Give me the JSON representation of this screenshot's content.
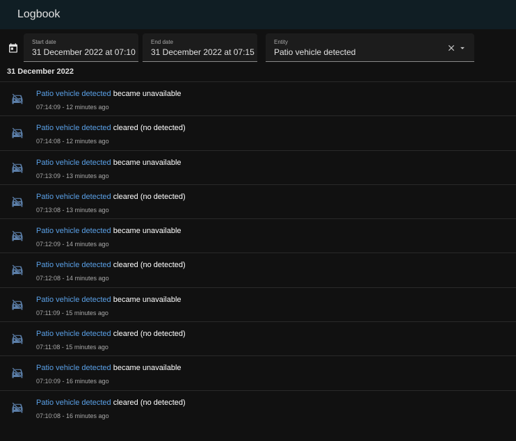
{
  "header": {
    "title": "Logbook"
  },
  "filters": {
    "start": {
      "label": "Start date",
      "value": "31 December 2022 at 07:10"
    },
    "end": {
      "label": "End date",
      "value": "31 December 2022 at 07:15"
    },
    "entity": {
      "label": "Entity",
      "value": "Patio vehicle detected"
    }
  },
  "date_group": "31 December 2022",
  "entries": [
    {
      "entity": "Patio vehicle detected",
      "action": "became unavailable",
      "time": "07:14:09 - 12 minutes ago"
    },
    {
      "entity": "Patio vehicle detected",
      "action": "cleared (no detected)",
      "time": "07:14:08 - 12 minutes ago"
    },
    {
      "entity": "Patio vehicle detected",
      "action": "became unavailable",
      "time": "07:13:09 - 13 minutes ago"
    },
    {
      "entity": "Patio vehicle detected",
      "action": "cleared (no detected)",
      "time": "07:13:08 - 13 minutes ago"
    },
    {
      "entity": "Patio vehicle detected",
      "action": "became unavailable",
      "time": "07:12:09 - 14 minutes ago"
    },
    {
      "entity": "Patio vehicle detected",
      "action": "cleared (no detected)",
      "time": "07:12:08 - 14 minutes ago"
    },
    {
      "entity": "Patio vehicle detected",
      "action": "became unavailable",
      "time": "07:11:09 - 15 minutes ago"
    },
    {
      "entity": "Patio vehicle detected",
      "action": "cleared (no detected)",
      "time": "07:11:08 - 15 minutes ago"
    },
    {
      "entity": "Patio vehicle detected",
      "action": "became unavailable",
      "time": "07:10:09 - 16 minutes ago"
    },
    {
      "entity": "Patio vehicle detected",
      "action": "cleared (no detected)",
      "time": "07:10:08 - 16 minutes ago"
    }
  ],
  "icons": {
    "calendar": "calendar-icon",
    "row": "car-off-icon",
    "clear": "close-icon",
    "dropdown": "menu-down-icon"
  },
  "colors": {
    "link": "#5aa0e6",
    "icon": "#5b7ea8",
    "topbar": "#101e24",
    "background": "#111111"
  }
}
